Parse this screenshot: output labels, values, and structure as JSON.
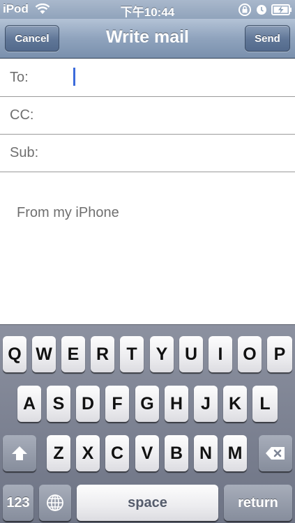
{
  "status_bar": {
    "carrier": "iPod",
    "time": "下午10:44"
  },
  "icons": {
    "wifi": "wifi-icon",
    "rotation_lock": "rotation-lock-icon",
    "alarm": "alarm-icon",
    "battery": "battery-charging-icon",
    "shift": "shift-arrow-icon",
    "delete": "backspace-icon",
    "globe": "globe-icon"
  },
  "nav": {
    "cancel_label": "Cancel",
    "title": "Write mail",
    "send_label": "Send"
  },
  "fields": {
    "to_label": "To:",
    "cc_label": "CC:",
    "sub_label": "Sub:"
  },
  "body": {
    "signature": "From my iPhone"
  },
  "keyboard": {
    "row1": [
      "Q",
      "W",
      "E",
      "R",
      "T",
      "Y",
      "U",
      "I",
      "O",
      "P"
    ],
    "row2": [
      "A",
      "S",
      "D",
      "F",
      "G",
      "H",
      "J",
      "K",
      "L"
    ],
    "row3": [
      "Z",
      "X",
      "C",
      "V",
      "B",
      "N",
      "M"
    ],
    "numbers_label": "123",
    "space_label": "space",
    "return_label": "return"
  },
  "colors": {
    "nav_tint": "#7a90ad",
    "caret": "#3c6bdb"
  }
}
